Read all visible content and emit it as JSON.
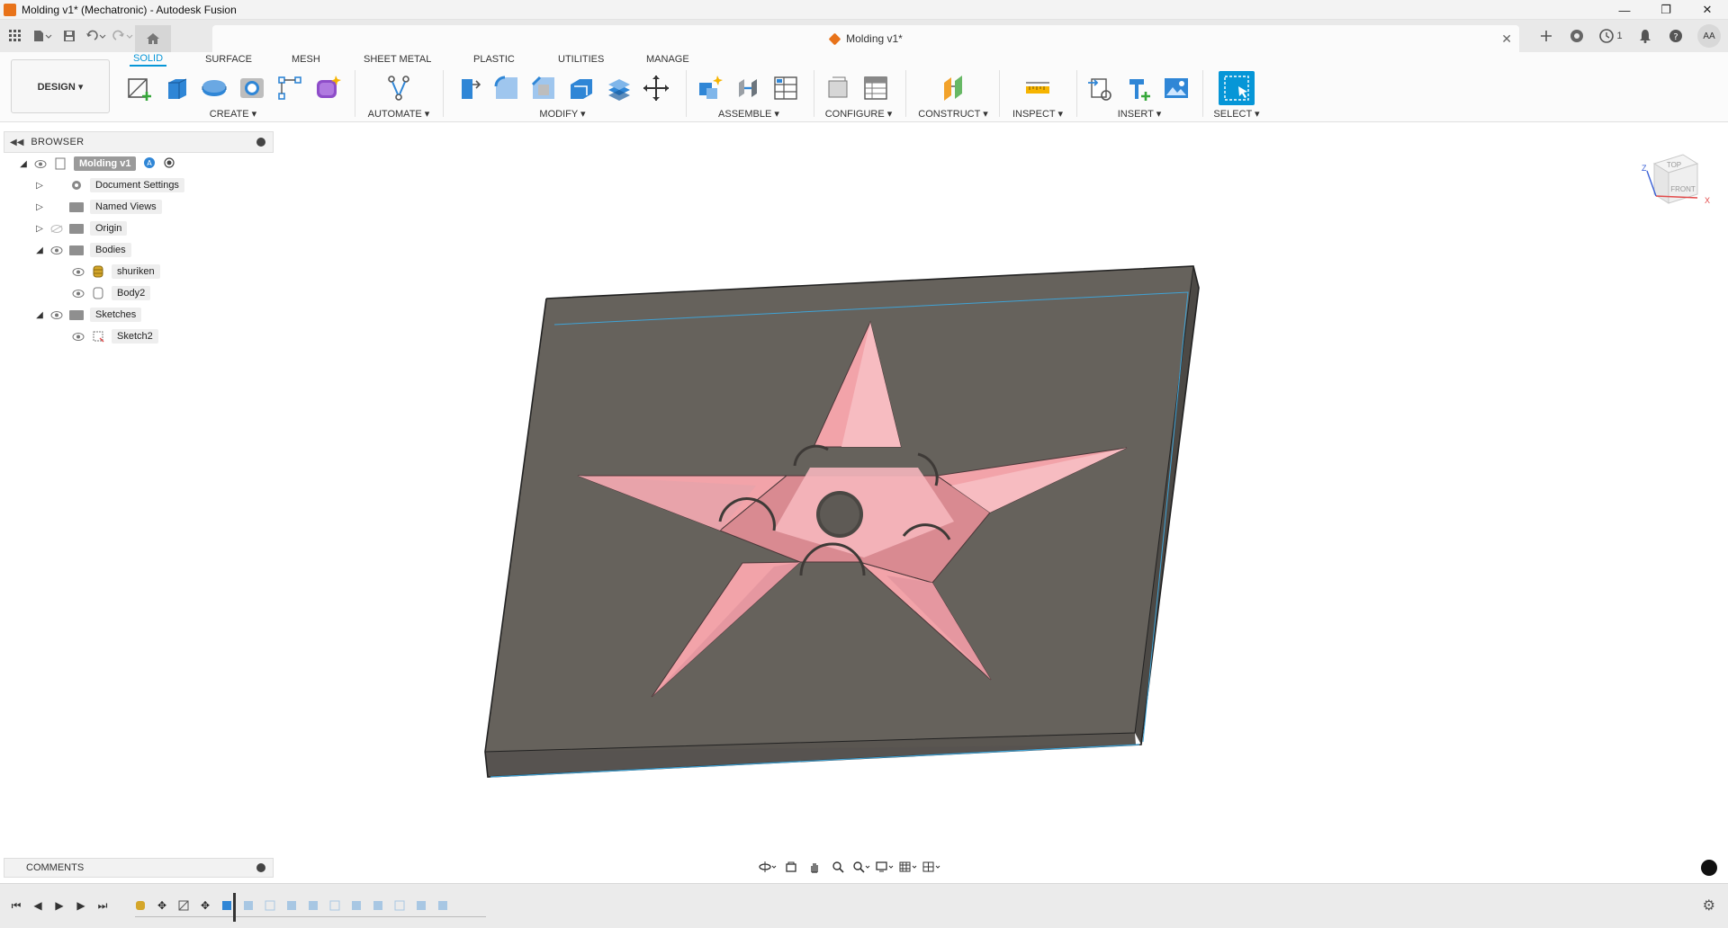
{
  "titlebar": {
    "title": "Molding v1* (Mechatronic) - Autodesk Fusion",
    "minimize": "—",
    "restore": "❐",
    "close": "✕"
  },
  "quick_access": {
    "doc_title": "Molding v1*",
    "close": "✕",
    "job_count": "1",
    "avatar": "AA"
  },
  "ribbon": {
    "workspace": "DESIGN ▾",
    "tabs": [
      "SOLID",
      "SURFACE",
      "MESH",
      "SHEET METAL",
      "PLASTIC",
      "UTILITIES",
      "MANAGE"
    ],
    "active_tab": "SOLID",
    "groups": {
      "create": "CREATE ▾",
      "automate": "AUTOMATE ▾",
      "modify": "MODIFY ▾",
      "assemble": "ASSEMBLE ▾",
      "configure": "CONFIGURE ▾",
      "construct": "CONSTRUCT ▾",
      "inspect": "INSPECT ▾",
      "insert": "INSERT ▾",
      "select": "SELECT ▾"
    }
  },
  "browser": {
    "title": "BROWSER",
    "root": "Molding v1",
    "nodes": {
      "document_settings": "Document Settings",
      "named_views": "Named Views",
      "origin": "Origin",
      "bodies": "Bodies",
      "shuriken": "shuriken",
      "body2": "Body2",
      "sketches": "Sketches",
      "sketch2": "Sketch2"
    }
  },
  "viewcube": {
    "top": "TOP",
    "front": "FRONT",
    "z": "Z",
    "x": "X"
  },
  "comments": {
    "label": "COMMENTS"
  },
  "colors": {
    "accent": "#0696d7",
    "plate": "#66625c",
    "star": "#f2a3a9",
    "app_orange": "#e8731a"
  }
}
